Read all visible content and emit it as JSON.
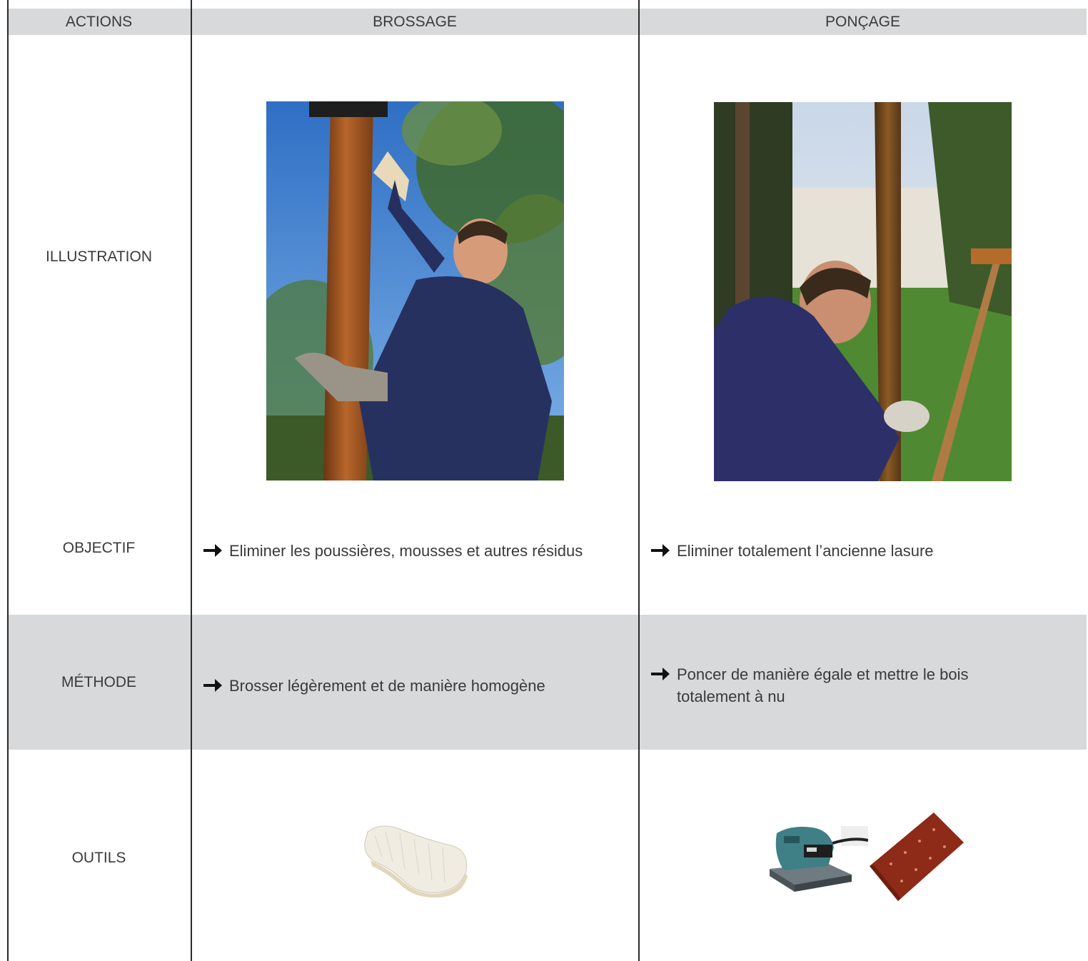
{
  "header": {
    "actions": "ACTIONS",
    "brossage": "BROSSAGE",
    "poncage": "PONÇAGE"
  },
  "rows": {
    "illustration": "ILLUSTRATION",
    "objectif": "OBJECTIF",
    "methode": "MÉTHODE",
    "outils": "OUTILS"
  },
  "objectif": {
    "brossage": "Eliminer les poussières, mousses et autres résidus",
    "poncage": "Eliminer totalement l’ancienne lasure"
  },
  "methode": {
    "brossage": "Brosser légèrement et de manière homogène",
    "poncage": "Poncer de manière égale et mettre le bois totalement à nu"
  },
  "colors": {
    "header_band": "#d8d9db",
    "row_band": "#d8d9db",
    "grid_line": "#2a2a2a",
    "text": "#3a3a3a"
  },
  "icons": {
    "bullet": "right-arrow-icon"
  }
}
